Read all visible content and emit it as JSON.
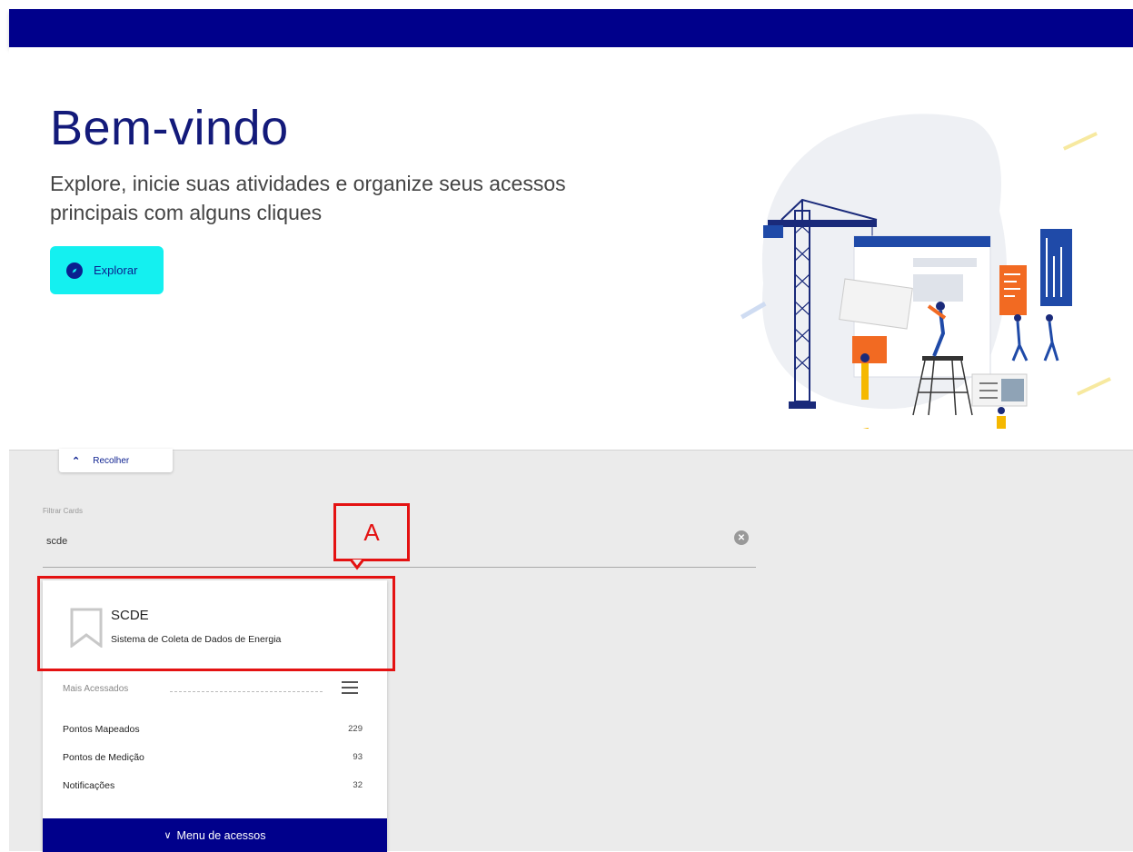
{
  "hero": {
    "title": "Bem-vindo",
    "subtitle": "Explore, inicie suas atividades e organize seus acessos principais com alguns cliques",
    "explore_label": "Explorar"
  },
  "collapse": {
    "label": "Recolher"
  },
  "filter": {
    "label": "Filtrar Cards",
    "value": "scde"
  },
  "annotation": {
    "label": "A"
  },
  "card": {
    "title": "SCDE",
    "subtitle": "Sistema de Coleta de Dados de Energia",
    "most_accessed_label": "Mais Acessados",
    "rows": [
      {
        "label": "Pontos Mapeados",
        "value": "229"
      },
      {
        "label": "Pontos de Medição",
        "value": "93"
      },
      {
        "label": "Notificações",
        "value": "32"
      }
    ],
    "menu_button_label": "Menu de acessos"
  },
  "colors": {
    "primary": "#00008b",
    "accent": "#14f0f0",
    "annotation": "#e41212"
  }
}
